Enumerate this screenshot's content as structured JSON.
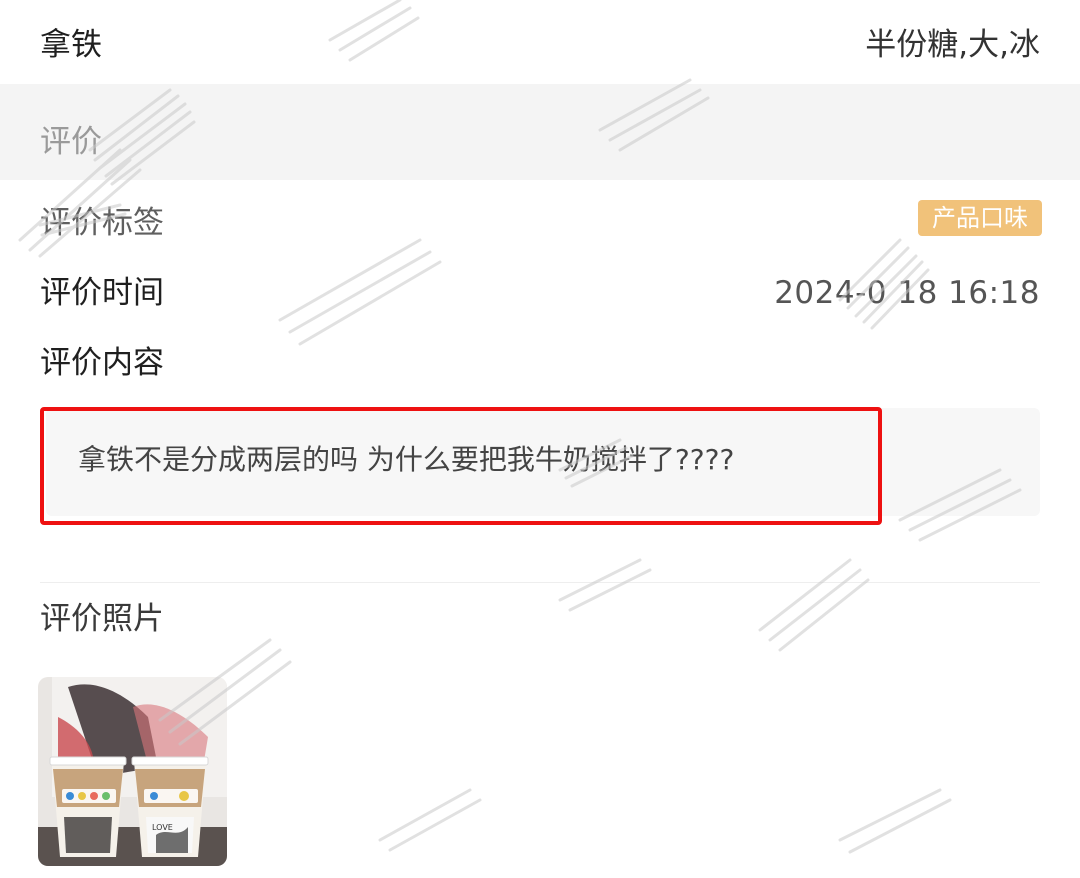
{
  "order": {
    "product_name": "拿铁",
    "product_spec": "半份糖,大,冰"
  },
  "review": {
    "section_label_partial": "评价",
    "tags_label": "评价标签",
    "tag": "产品口味",
    "time_label": "评价时间",
    "time_value": "2024-0  18 16:18",
    "content_label": "评价内容",
    "content_text": "拿铁不是分成两层的吗 为什么要把我牛奶搅拌了????",
    "photos_label": "评价照片"
  },
  "photo": {
    "cup_text": "LOVE"
  },
  "colors": {
    "highlight_border": "#ee1111",
    "tag_background": "#f1c27a",
    "grey_band": "#f4f4f4"
  }
}
